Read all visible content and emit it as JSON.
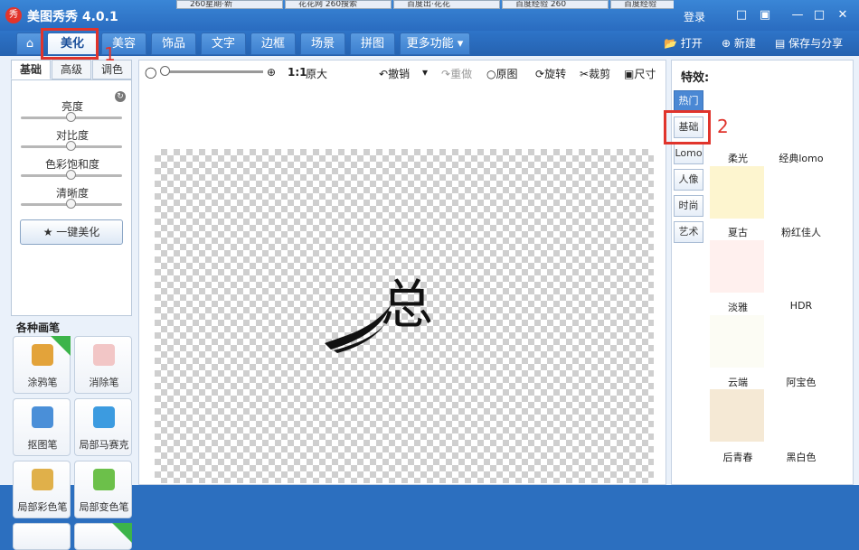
{
  "app": {
    "title": "美图秀秀 4.0.1",
    "logo": "秀",
    "login": "登录"
  },
  "browser_tabs": [
    "260星期·新",
    "花花网 260搜索",
    "百度出·花花",
    "百度经验 260",
    "百度经验"
  ],
  "menu_tabs": [
    "美化",
    "美容",
    "饰品",
    "文字",
    "边框",
    "场景",
    "拼图",
    "更多功能 ▾"
  ],
  "actions": {
    "open": "打开",
    "new": "新建",
    "save_share": "保存与分享"
  },
  "annotations": {
    "marker1": "1",
    "marker2": "2"
  },
  "left_tabs": [
    "基础",
    "高级",
    "调色"
  ],
  "adjustments": [
    {
      "label": "亮度",
      "value": 0.5
    },
    {
      "label": "对比度",
      "value": 0.5
    },
    {
      "label": "色彩饱和度",
      "value": 0.5
    },
    {
      "label": "清晰度",
      "value": 0.5
    }
  ],
  "auto_button": "一键美化",
  "pens_title": "各种画笔",
  "pens": [
    "涂鸦笔",
    "消除笔",
    "抠图笔",
    "局部马赛克",
    "局部彩色笔",
    "局部变色笔"
  ],
  "toolbar": {
    "zoom_ratio": "1:1",
    "original_size": "原大",
    "undo": "撤销",
    "redo": "重做",
    "original": "原图",
    "rotate": "旋转",
    "crop": "裁剪",
    "size": "尺寸"
  },
  "canvas_text": "总",
  "effects": {
    "title": "特效:",
    "categories": [
      "热门",
      "基础",
      "Lomo",
      "人像",
      "时尚",
      "艺术"
    ],
    "items": [
      "柔光",
      "经典lomo",
      "夏古",
      "粉红佳人",
      "淡雅",
      "HDR",
      "云端",
      "阿宝色",
      "后青春",
      "黑白色"
    ],
    "thumb_colors": [
      "#fdf5cf",
      "#fff0ee",
      "#fcfcf4",
      "#f5e9d5"
    ]
  }
}
